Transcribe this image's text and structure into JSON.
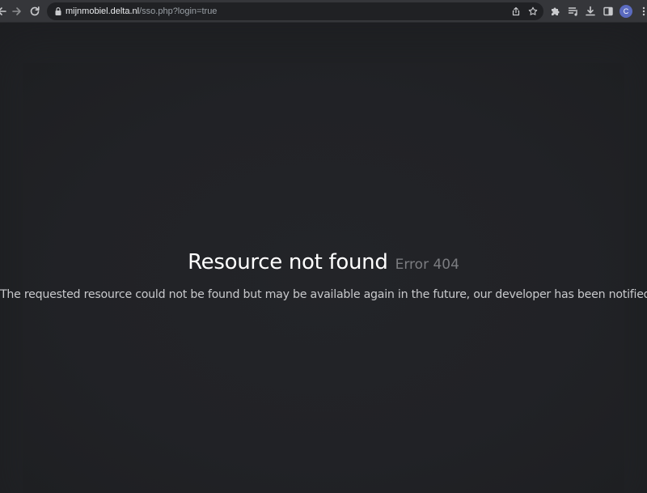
{
  "browser": {
    "url_host": "mijnmobiel.delta.nl",
    "url_path": "/sso.php?login=true",
    "profile_initial": "C",
    "icons": {
      "back": "arrow-left-icon",
      "forward": "arrow-right-icon",
      "reload": "reload-icon",
      "lock": "lock-icon",
      "share": "share-icon",
      "bookmark": "star-icon",
      "extensions": "puzzle-icon",
      "media": "playlist-icon",
      "downloads": "download-icon",
      "sidepanel": "side-panel-icon",
      "menu": "kebab-menu-icon"
    },
    "colors": {
      "toolbar": "#35363a",
      "omnibox": "#202124",
      "avatar": "#5b6bc0"
    }
  },
  "page": {
    "title": "Resource not found",
    "error_code": "Error 404",
    "message": "The requested resource could not be found but may be available again in the future, our developer has been notified.",
    "colors": {
      "background": "#1d1e21",
      "title": "#ffffff",
      "code": "#7b7c80",
      "message": "#c8c9cc"
    }
  }
}
